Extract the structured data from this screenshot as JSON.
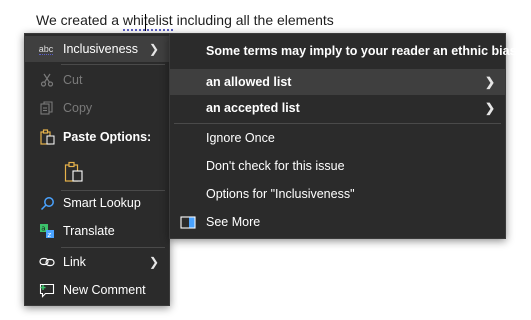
{
  "document": {
    "text_before_flag": "We created a ",
    "flagged_word": "whitelist",
    "text_after_flag": " including all the elements"
  },
  "context_menu": {
    "inclusiveness_label": "Inclusiveness",
    "cut_label": "Cut",
    "copy_label": "Copy",
    "paste_options_label": "Paste Options:",
    "smart_lookup_label": "Smart Lookup",
    "translate_label": "Translate",
    "link_label": "Link",
    "new_comment_label": "New Comment",
    "abc_text": "abc"
  },
  "submenu": {
    "header": "Some terms may imply to your reader an ethnic bias",
    "suggestions": [
      "an allowed list",
      "an accepted list"
    ],
    "ignore_once_label": "Ignore Once",
    "dont_check_label": "Don't check for this issue",
    "options_label": "Options for \"Inclusiveness\"",
    "see_more_label": "See More"
  },
  "colors": {
    "menu_bg": "#2b2b2b",
    "highlight": "#3f3f3f",
    "disabled_text": "#7a7a7a",
    "editor_flag": "#5b5fc7",
    "icon_blue": "#4aa3ff",
    "icon_green": "#3cc36b",
    "icon_gold": "#e6b24a"
  }
}
